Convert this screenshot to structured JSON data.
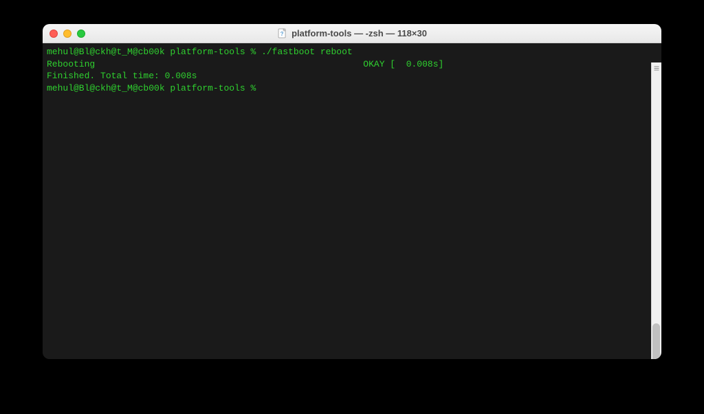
{
  "window": {
    "title": "platform-tools — -zsh — 118×30",
    "folder_icon": "📄"
  },
  "terminal": {
    "lines": [
      {
        "prompt": "mehul@Bl@ckh@t_M@cb00k platform-tools % ",
        "command": "./fastboot reboot"
      },
      {
        "text_left": "Rebooting",
        "text_right": "OKAY [  0.008s]"
      },
      {
        "text": "Finished. Total time: 0.008s"
      },
      {
        "prompt": "mehul@Bl@ckh@t_M@cb00k platform-tools % ",
        "command": ""
      }
    ]
  }
}
